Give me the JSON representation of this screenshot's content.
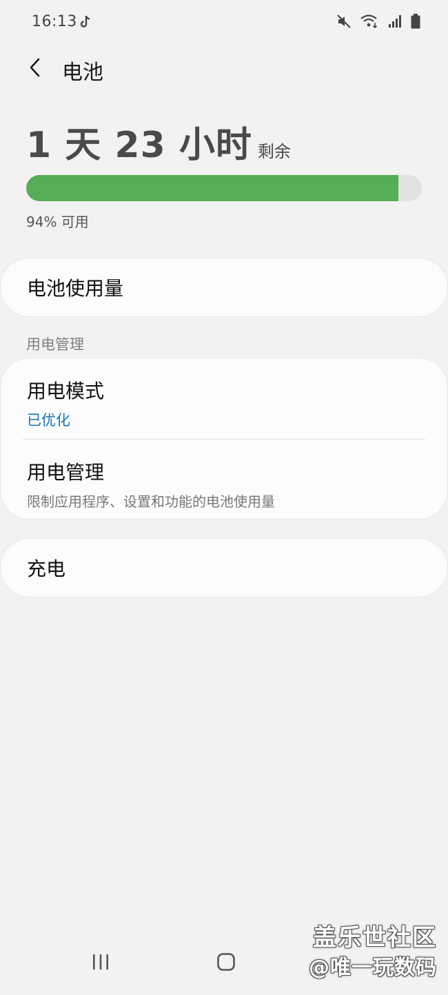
{
  "status_bar": {
    "time": "16:13",
    "icons": [
      "tiktok-icon",
      "mute-icon",
      "wifi-icon",
      "signal-icon",
      "battery-icon"
    ]
  },
  "header": {
    "back_icon": "chevron-left-icon",
    "title": "电池"
  },
  "battery": {
    "remaining_value": "1 天 23 小时",
    "remaining_suffix": "剩余",
    "level_percent": 94,
    "available_text": "94% 可用",
    "bar_color": "#56ad55"
  },
  "cards": {
    "usage_label": "电池使用量",
    "section_header": "用电管理",
    "power_mode": {
      "title": "用电模式",
      "value": "已优化"
    },
    "power_management": {
      "title": "用电管理",
      "subtitle": "限制应用程序、设置和功能的电池使用量"
    },
    "charging_label": "充电"
  },
  "nav_bar": {
    "items": [
      "recents-icon",
      "home-icon"
    ]
  },
  "watermark": {
    "line1": "盖乐世社区",
    "line2": "@唯一玩数码"
  },
  "colors": {
    "background": "#f2f2f2",
    "accent_blue": "#1873b2",
    "battery_green": "#56ad55"
  }
}
